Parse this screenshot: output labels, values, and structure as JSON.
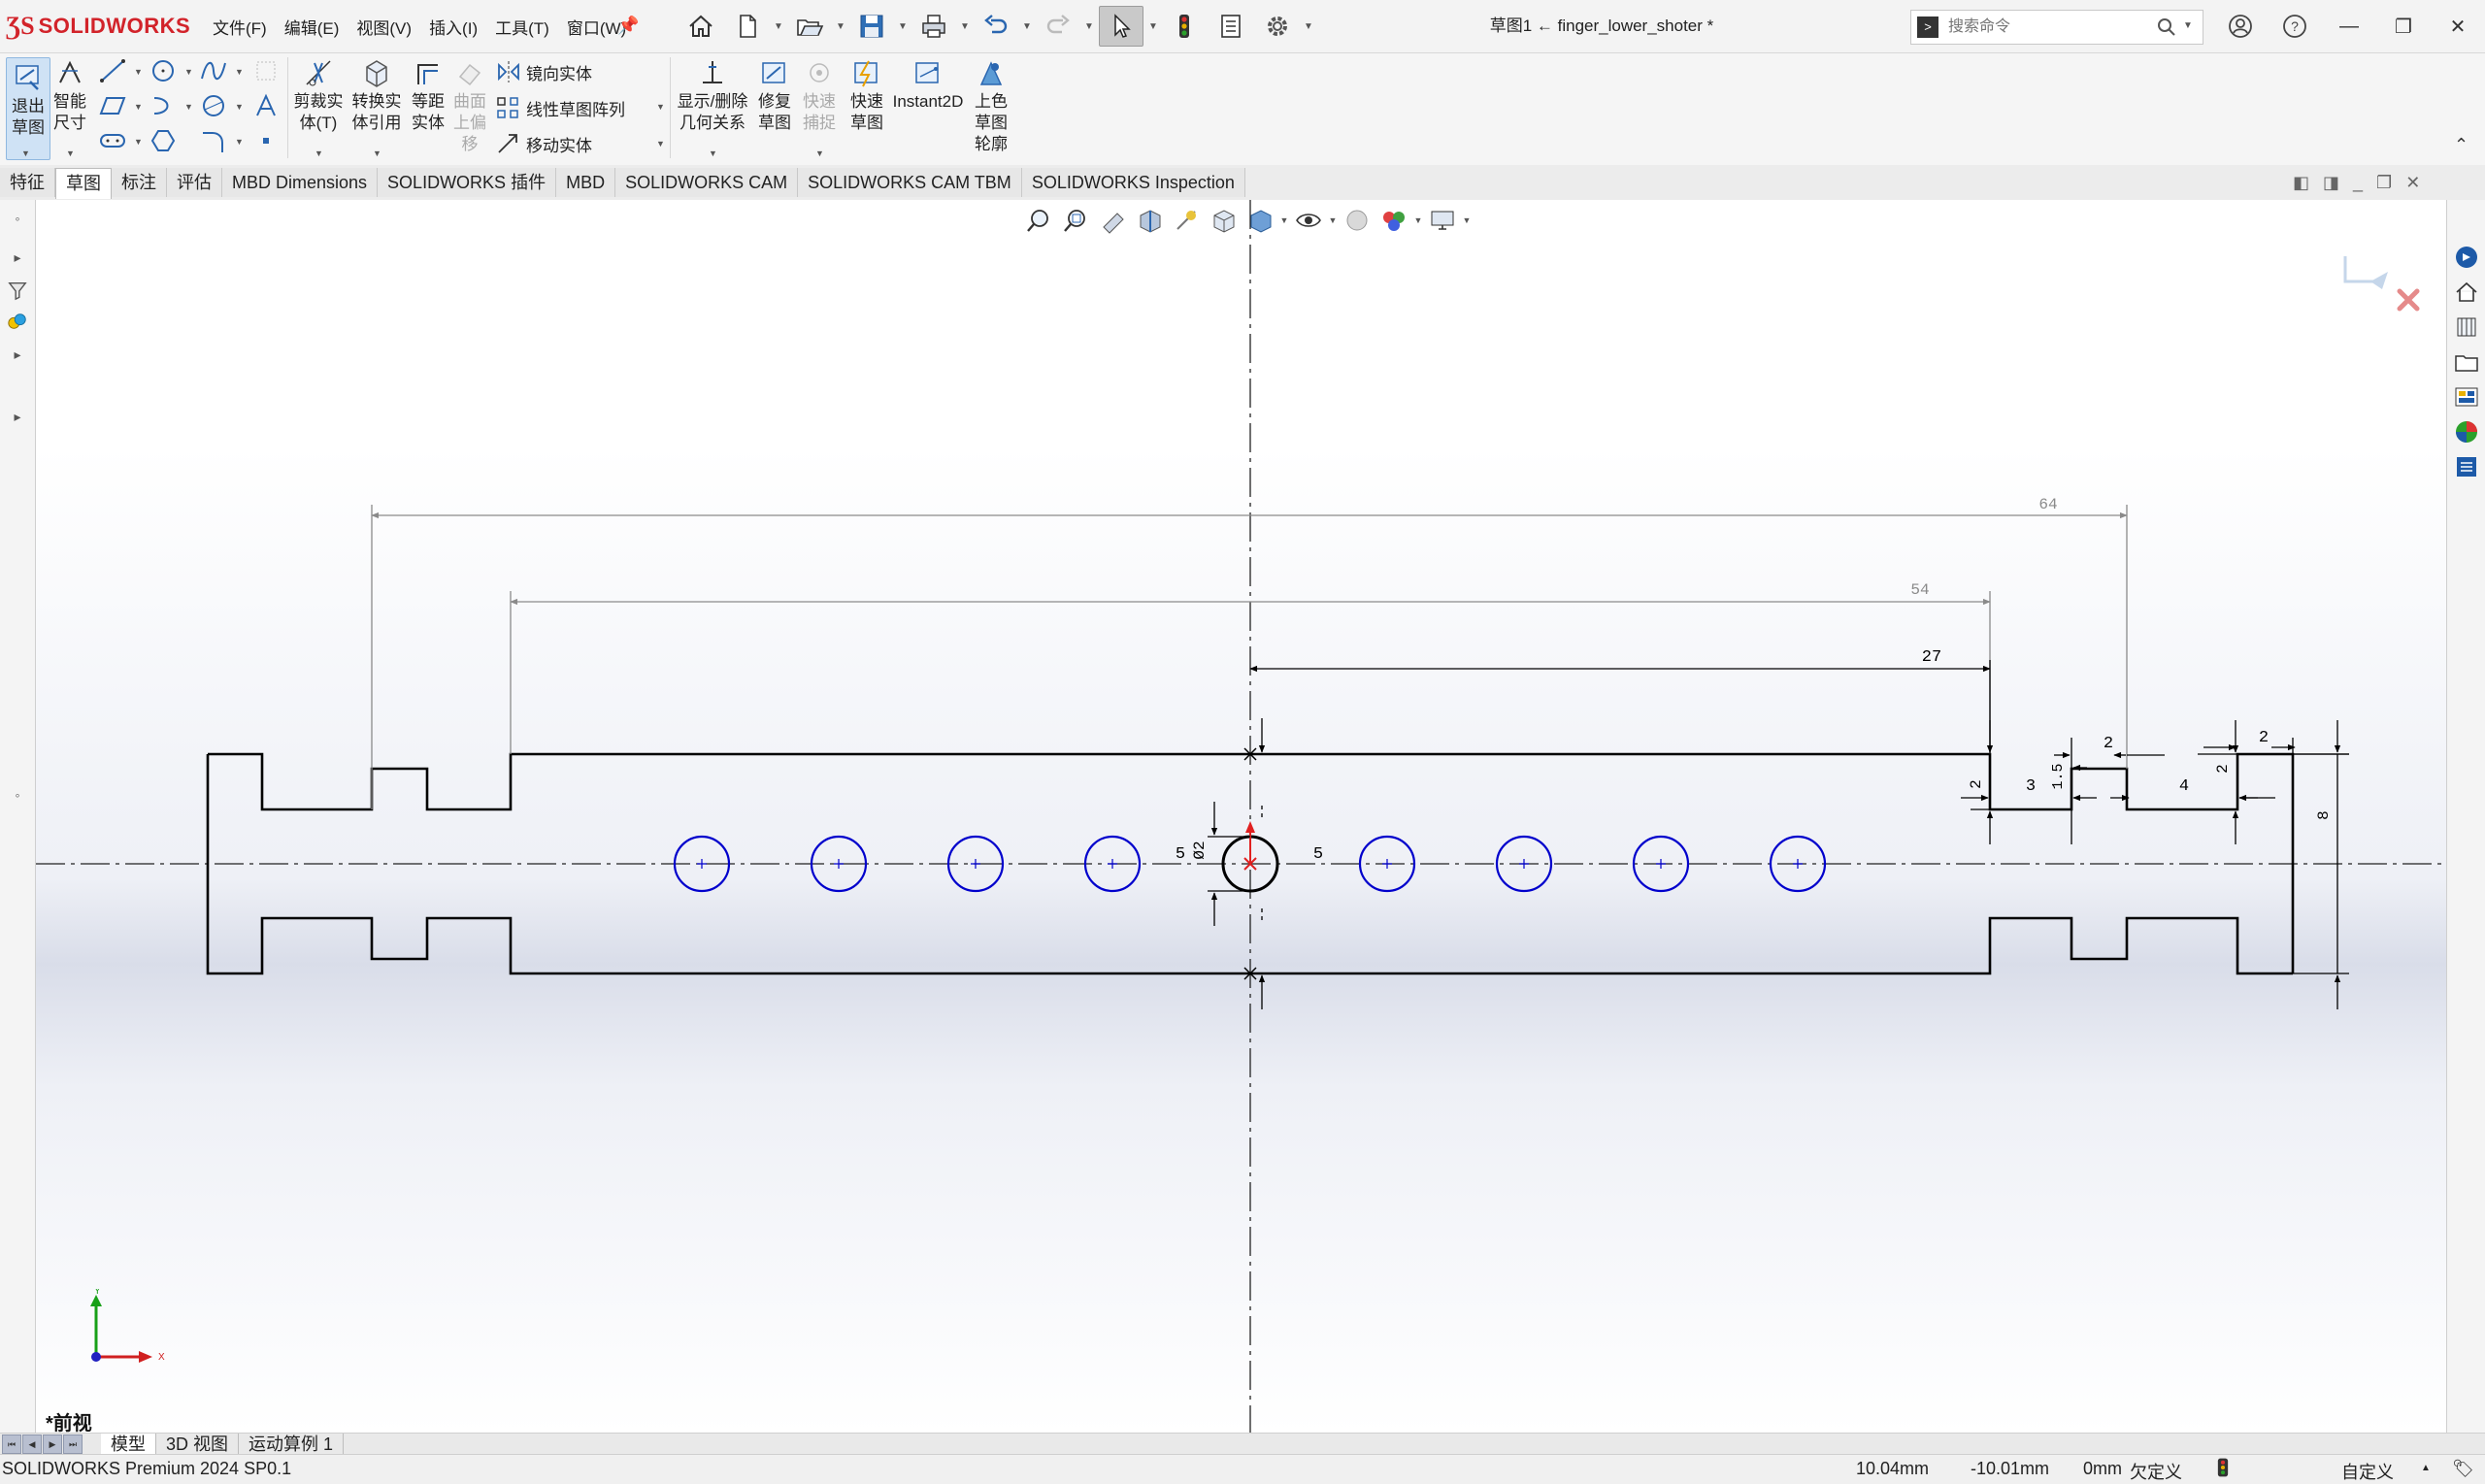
{
  "app": {
    "brand": "SOLIDWORKS",
    "document_title": "草图1 ← finger_lower_shoter *"
  },
  "menu": [
    "文件(F)",
    "编辑(E)",
    "视图(V)",
    "插入(I)",
    "工具(T)",
    "窗口(W)"
  ],
  "search": {
    "placeholder": "搜索命令"
  },
  "ribbon": {
    "exit_sketch": "退出\n草图",
    "smart_dimension": "智能\n尺寸",
    "trim": "剪裁实\n体(T)",
    "convert": "转换实\n体引用",
    "offset": "等距\n实体",
    "surface_offset": "曲面\n上偏\n移",
    "mirror": "镜向实体",
    "linear_pattern": "线性草图阵列",
    "move": "移动实体",
    "relations": "显示/删除\n几何关系",
    "repair": "修复\n草图",
    "quick_snaps": "快速\n捕捉",
    "rapid_sketch": "快速\n草图",
    "instant2d": "Instant2D",
    "shaded_contours": "上色\n草图\n轮廓"
  },
  "tabs": [
    {
      "label": "特征",
      "active": false
    },
    {
      "label": "草图",
      "active": true
    },
    {
      "label": "标注",
      "active": false
    },
    {
      "label": "评估",
      "active": false
    },
    {
      "label": "MBD Dimensions",
      "active": false
    },
    {
      "label": "SOLIDWORKS 插件",
      "active": false
    },
    {
      "label": "MBD",
      "active": false
    },
    {
      "label": "SOLIDWORKS CAM",
      "active": false
    },
    {
      "label": "SOLIDWORKS CAM TBM",
      "active": false
    },
    {
      "label": "SOLIDWORKS Inspection",
      "active": false
    }
  ],
  "sketch": {
    "dimensions": {
      "overall_right": "64",
      "inner_right": "54",
      "center_to_step": "27",
      "hole_dia": "Ø2",
      "hole_left": "5",
      "hole_right": "5",
      "step_w1": "3",
      "step_h1": "2",
      "step_h2": "1.5",
      "groove_top": "2",
      "groove_w": "4",
      "end_top": "2",
      "end_h": "2",
      "total_height": "8"
    },
    "axis_labels": {
      "x": "X",
      "y": "Y"
    },
    "view_name": "*前视",
    "colors": {
      "geometry": "#000000",
      "circles": "#0000cc",
      "dimension": "#7a7a7a",
      "origin": "#e02020"
    }
  },
  "bottom_tabs": [
    {
      "label": "模型",
      "active": true
    },
    {
      "label": "3D 视图",
      "active": false
    },
    {
      "label": "运动算例 1",
      "active": false
    }
  ],
  "status": {
    "product": "SOLIDWORKS Premium 2024 SP0.1",
    "x": "10.04mm",
    "y": "-10.01mm",
    "z": "0mm",
    "state": "欠定义",
    "units": "自定义"
  }
}
